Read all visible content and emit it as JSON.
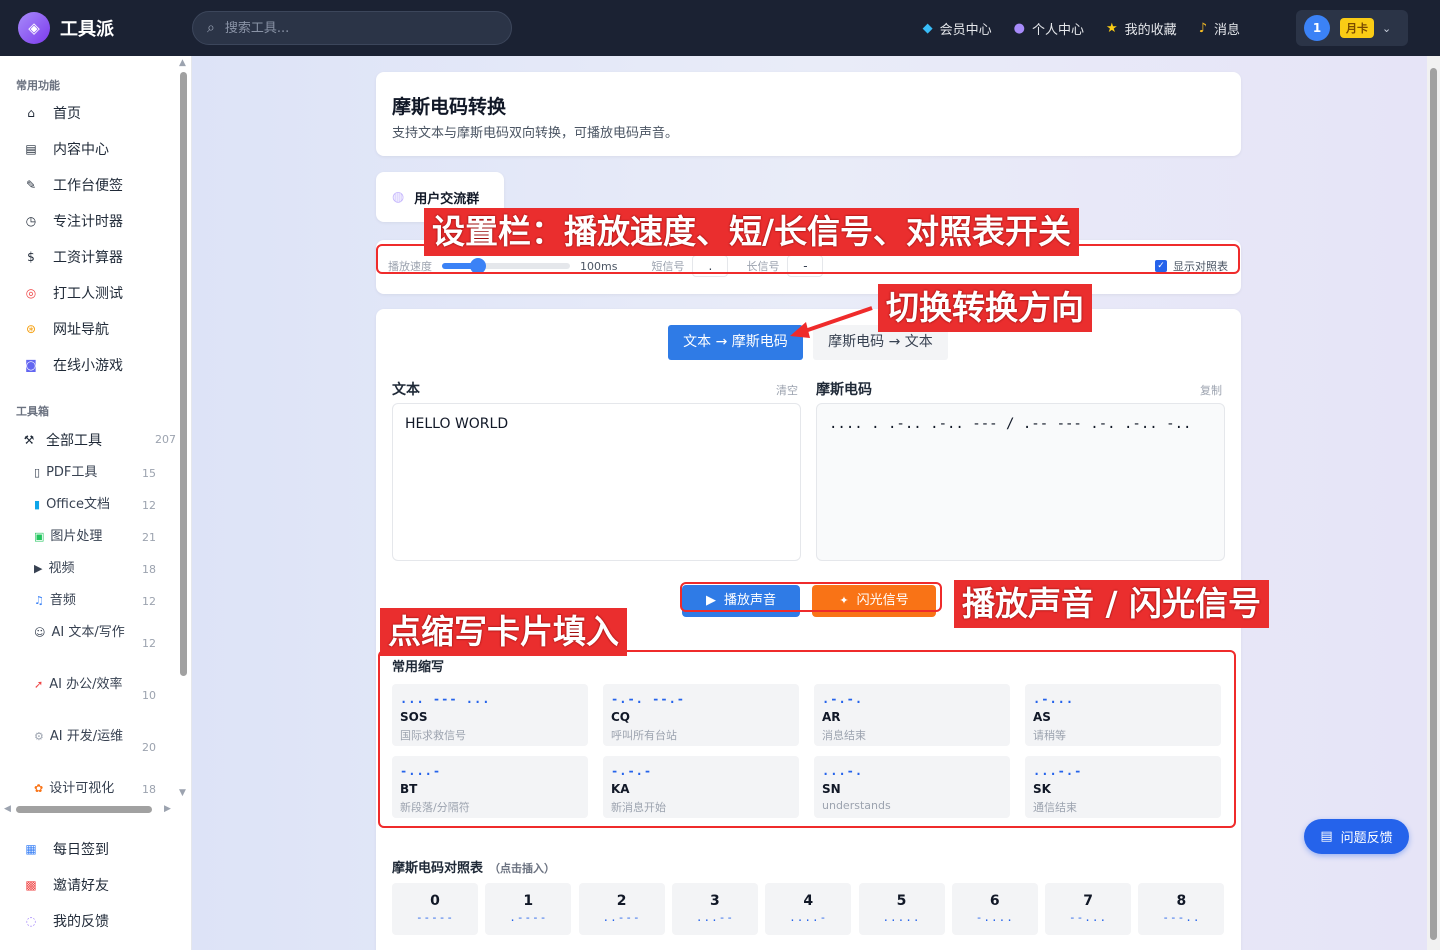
{
  "topbar": {
    "logo_text": "工具派",
    "search_placeholder": "搜索工具...",
    "nav": [
      {
        "icon": "diamond-icon",
        "label": "会员中心"
      },
      {
        "icon": "user-icon",
        "label": "个人中心"
      },
      {
        "icon": "star-icon",
        "label": "我的收藏"
      },
      {
        "icon": "bell-icon",
        "label": "消息"
      }
    ],
    "avatar": "1",
    "plan_badge": "月卡"
  },
  "sidebar": {
    "section_common": "常用功能",
    "common": [
      "首页",
      "内容中心",
      "工作台便签",
      "专注计时器",
      "工资计算器",
      "打工人测试",
      "网址导航",
      "在线小游戏"
    ],
    "section_toolbox": "工具箱",
    "all_tools": {
      "label": "全部工具",
      "count": "207"
    },
    "tools": [
      {
        "label": "PDF工具",
        "count": "15"
      },
      {
        "label": "Office文档",
        "count": "12"
      },
      {
        "label": "图片处理",
        "count": "21"
      },
      {
        "label": "视频",
        "count": "18"
      },
      {
        "label": "音频",
        "count": "12"
      },
      {
        "label": "AI 文本/写作",
        "count": "12"
      },
      {
        "label": "AI 办公/效率",
        "count": "10"
      },
      {
        "label": "AI 开发/运维",
        "count": "20"
      },
      {
        "label": "设计可视化",
        "count": "18"
      }
    ],
    "bottom": [
      "每日签到",
      "邀请好友",
      "我的反馈"
    ]
  },
  "header": {
    "title": "摩斯电码转换",
    "subtitle": "支持文本与摩斯电码双向转换，可播放电码声音。"
  },
  "community": {
    "label": "用户交流群"
  },
  "settings": {
    "speed_label": "播放速度",
    "speed_value": "100ms",
    "speed_fraction": 0.28,
    "short_label": "短信号",
    "short_value": ".",
    "long_label": "长信号",
    "long_value": "-",
    "show_table_label": "显示对照表",
    "show_table_checked": true
  },
  "converter": {
    "tab_active": "文本 → 摩斯电码",
    "tab_inactive": "摩斯电码 → 文本",
    "text_label": "文本",
    "clear_label": "清空",
    "morse_label": "摩斯电码",
    "copy_label": "复制",
    "text_value": "HELLO WORLD",
    "morse_value": ".... . .-.. .-.. --- / .-- --- .-. .-.. -..",
    "play_label": "播放声音",
    "flash_label": "闪光信号"
  },
  "abbreviations": {
    "title": "常用缩写",
    "items": [
      {
        "code": "... --- ...",
        "name": "SOS",
        "desc": "国际求救信号"
      },
      {
        "code": "-.-. --.-",
        "name": "CQ",
        "desc": "呼叫所有台站"
      },
      {
        "code": ".-.-.",
        "name": "AR",
        "desc": "消息结束"
      },
      {
        "code": ".-...",
        "name": "AS",
        "desc": "请稍等"
      },
      {
        "code": "-...-",
        "name": "BT",
        "desc": "新段落/分隔符"
      },
      {
        "code": "-.-.-",
        "name": "KA",
        "desc": "新消息开始"
      },
      {
        "code": "...-.",
        "name": "SN",
        "desc": "understands"
      },
      {
        "code": "...-.-",
        "name": "SK",
        "desc": "通信结束"
      }
    ]
  },
  "table": {
    "title": "摩斯电码对照表",
    "hint": "（点击插入）",
    "items": [
      {
        "ch": "0",
        "code": "-----"
      },
      {
        "ch": "1",
        "code": ".----"
      },
      {
        "ch": "2",
        "code": "..---"
      },
      {
        "ch": "3",
        "code": "...--"
      },
      {
        "ch": "4",
        "code": "....-"
      },
      {
        "ch": "5",
        "code": "....."
      },
      {
        "ch": "6",
        "code": "-...."
      },
      {
        "ch": "7",
        "code": "--..."
      },
      {
        "ch": "8",
        "code": "---.."
      }
    ]
  },
  "annotations": {
    "settings": "设置栏：播放速度、短/长信号、对照表开关",
    "direction": "切换转换方向",
    "playback": "播放声音 / 闪光信号",
    "abbr": "点缩写卡片填入"
  },
  "feedback_label": "问题反馈"
}
